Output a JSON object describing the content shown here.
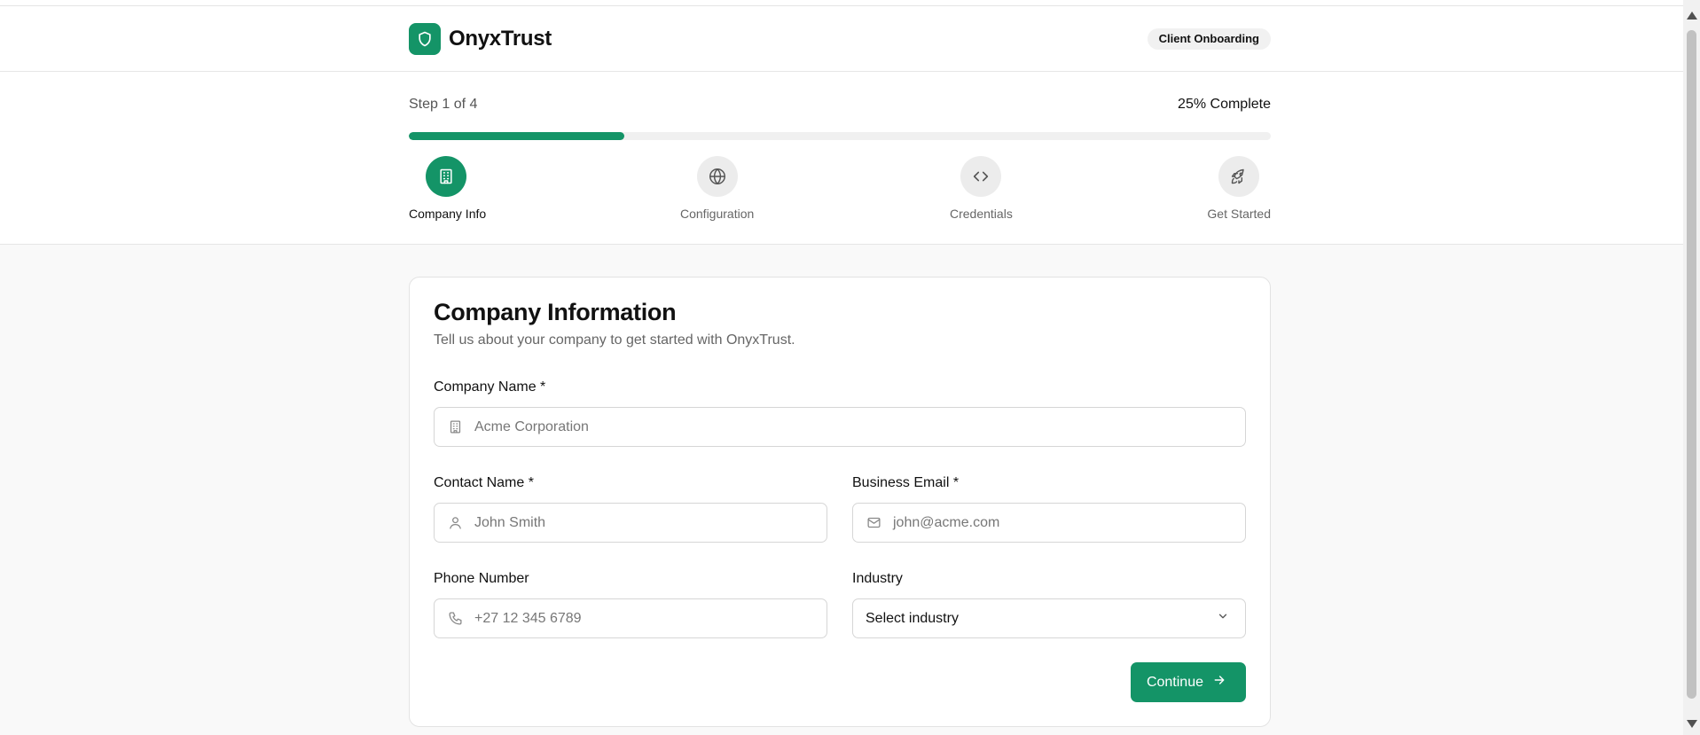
{
  "header": {
    "brand_name": "OnyxTrust",
    "logo_icon": "shield-icon",
    "badge": "Client Onboarding"
  },
  "progress": {
    "step_text": "Step 1 of 4",
    "percent_text": "25% Complete",
    "percent": 25,
    "steps": [
      {
        "label": "Company Info",
        "icon": "building-icon",
        "active": true
      },
      {
        "label": "Configuration",
        "icon": "globe-icon",
        "active": false
      },
      {
        "label": "Credentials",
        "icon": "code-icon",
        "active": false
      },
      {
        "label": "Get Started",
        "icon": "rocket-icon",
        "active": false
      }
    ]
  },
  "form": {
    "title": "Company Information",
    "subtitle": "Tell us about your company to get started with OnyxTrust.",
    "company_name": {
      "label": "Company Name *",
      "placeholder": "Acme Corporation",
      "icon": "building-icon"
    },
    "contact_name": {
      "label": "Contact Name *",
      "placeholder": "John Smith",
      "icon": "user-icon"
    },
    "business_email": {
      "label": "Business Email *",
      "placeholder": "john@acme.com",
      "icon": "mail-icon"
    },
    "phone": {
      "label": "Phone Number",
      "placeholder": "+27 12 345 6789",
      "icon": "phone-icon"
    },
    "industry": {
      "label": "Industry",
      "value": "Select industry",
      "icon": "chevron-down-icon"
    },
    "continue_label": "Continue"
  },
  "colors": {
    "accent": "#149467",
    "background": "#f9f9f9"
  }
}
